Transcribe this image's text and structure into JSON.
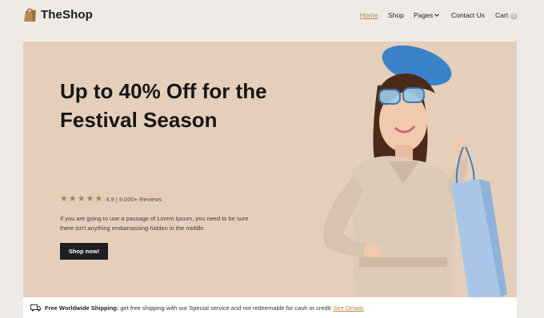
{
  "brand": {
    "name": "TheShop",
    "color": "#b6894a"
  },
  "nav": {
    "items": [
      {
        "label": "Home",
        "active": true
      },
      {
        "label": "Shop"
      },
      {
        "label": "Pages",
        "dropdown": true
      },
      {
        "label": "Contact Us"
      },
      {
        "label": "Cart",
        "badge": "0"
      }
    ]
  },
  "hero": {
    "title": "Up to 40% Off for the Festival Season",
    "rating": {
      "stars": 5,
      "text": "4.9 | 9,000+ Reviews"
    },
    "description": "If you are going to use a passage of Lorem Ipsum, you need to be sure there isn't anything embarrassing hidden in the middle.",
    "cta_label": "Shop now!",
    "background": "#e5cfbb"
  },
  "shipping": {
    "icon": "truck-icon",
    "title": "Free Worldwide Shipping:",
    "text": "get free shipping with our Special service and not redeemable for cash or credit",
    "link_label": "See Details"
  }
}
